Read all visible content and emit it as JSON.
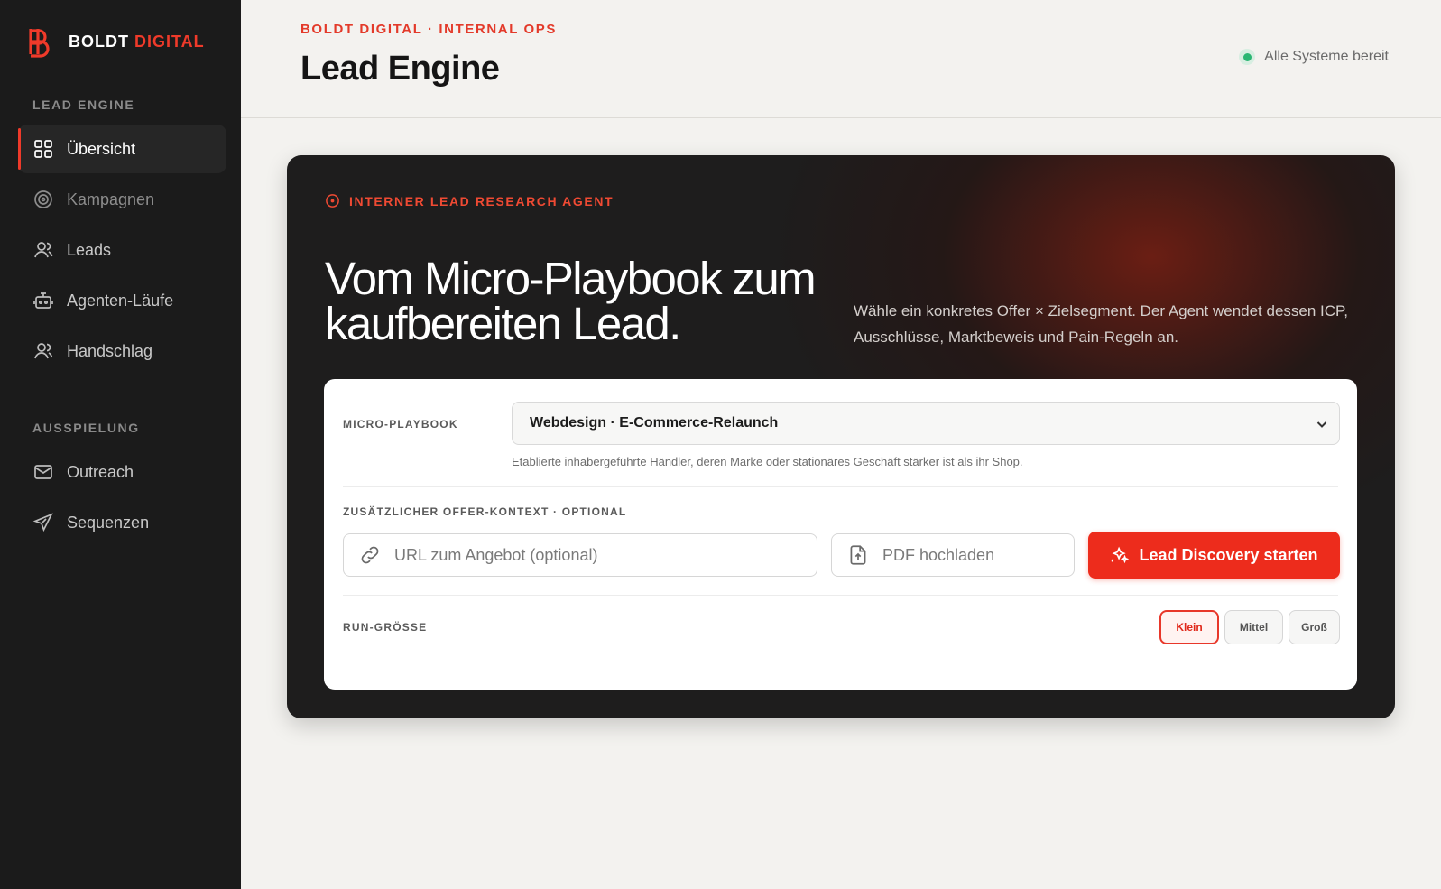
{
  "brand": {
    "name": "BOLDT",
    "accent": "DIGITAL"
  },
  "sidebar": {
    "section1": "LEAD ENGINE",
    "section2": "AUSSPIELUNG",
    "items": [
      {
        "label": "Übersicht",
        "icon": "grid-icon"
      },
      {
        "label": "Kampagnen",
        "icon": "target-icon"
      },
      {
        "label": "Leads",
        "icon": "user-icon"
      },
      {
        "label": "Agenten-Läufe",
        "icon": "robot-icon"
      },
      {
        "label": "Handschlag",
        "icon": "user-icon"
      },
      {
        "label": "Outreach",
        "icon": "mail-icon"
      },
      {
        "label": "Sequenzen",
        "icon": "send-icon"
      }
    ]
  },
  "header": {
    "eyebrow": "BOLDT DIGITAL · INTERNAL OPS",
    "title": "Lead Engine",
    "status": "Alle Systeme bereit"
  },
  "hero": {
    "tag": "INTERNER LEAD RESEARCH AGENT",
    "title": "Vom Micro-Playbook zum kaufbereiten Lead.",
    "description": "Wähle ein konkretes Offer × Zielsegment. Der Agent wendet dessen ICP, Ausschlüsse, Marktbeweis und Pain-Regeln an."
  },
  "form": {
    "playbook_label": "MICRO-PLAYBOOK",
    "playbook_value": "Webdesign · E-Commerce-Relaunch",
    "playbook_hint": "Etablierte inhabergeführte Händler, deren Marke oder stationäres Geschäft stärker ist als ihr Shop.",
    "context_label": "ZUSÄTZLICHER OFFER-KONTEXT · OPTIONAL",
    "url_placeholder": "URL zum Angebot (optional)",
    "pdf_label": "PDF hochladen",
    "cta_label": "Lead Discovery starten",
    "size_label": "RUN-GRÖSSE",
    "sizes": [
      "Klein",
      "Mittel",
      "Groß"
    ],
    "selected_size": "Klein"
  },
  "colors": {
    "accent": "#ed2c1c",
    "sidebar_bg": "#1b1b1b",
    "status_ok": "#2bb673"
  }
}
